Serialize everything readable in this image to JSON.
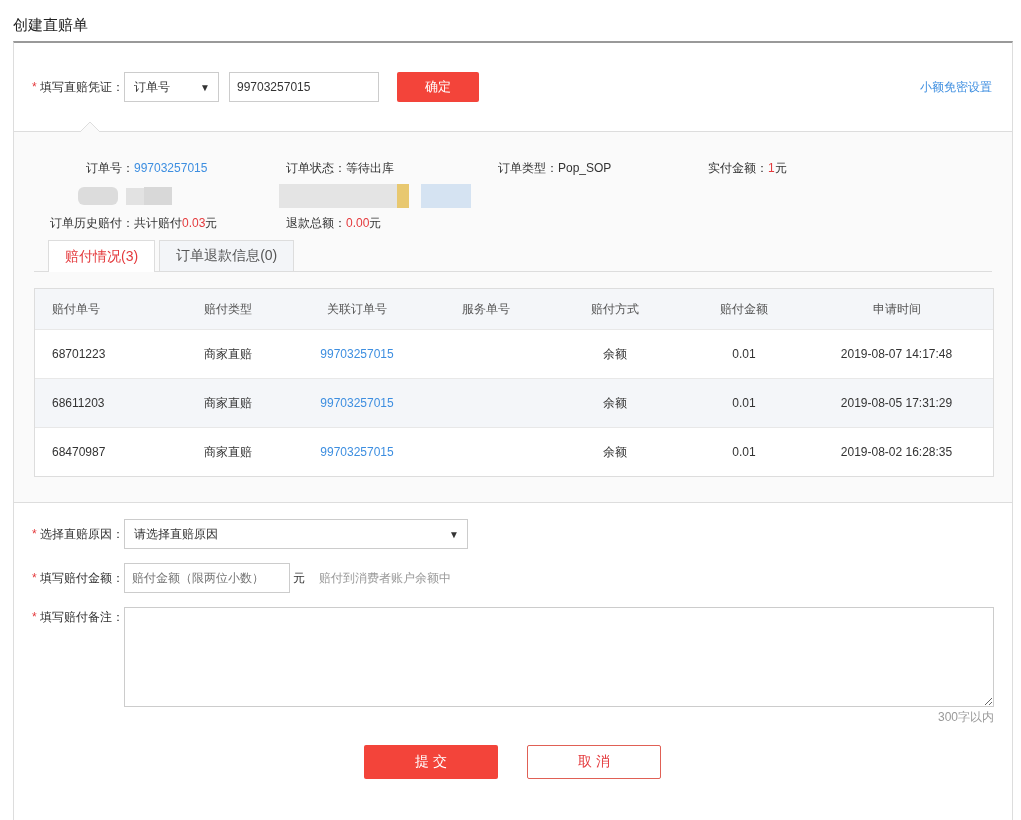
{
  "page_title": "创建直赔单",
  "voucher": {
    "label": "填写直赔凭证：",
    "select_value": "订单号",
    "select_arrow": "▼",
    "input_value": "99703257015",
    "confirm_button": "确定",
    "settings_link": "小额免密设置"
  },
  "order_info": {
    "rows": [
      [
        {
          "label": "订单号：",
          "value": "99703257015",
          "kind": "link"
        },
        {
          "label": "订单状态：等待出库",
          "kind": "plain"
        },
        {
          "label": "订单类型：Pop_SOP",
          "kind": "plain"
        },
        {
          "label": "实付金额：",
          "value": "1",
          "unit": "元",
          "kind": "amount"
        }
      ],
      [
        {
          "label": "订单历史赔付：共计赔付",
          "value": "0.03",
          "unit": "元",
          "kind": "amount"
        },
        {
          "label": "退款总额：",
          "value": "0.00",
          "unit": "元",
          "kind": "amount"
        }
      ]
    ]
  },
  "tabs": [
    {
      "label": "赔付情况(3)",
      "selected": true
    },
    {
      "label": "订单退款信息(0)",
      "selected": false
    }
  ],
  "table": {
    "columns": [
      "赔付单号",
      "赔付类型",
      "关联订单号",
      "服务单号",
      "赔付方式",
      "赔付金额",
      "申请时间"
    ],
    "rows": [
      [
        "68701223",
        "商家直赔",
        "99703257015",
        null,
        "余额",
        "0.01",
        "2019-08-07 14:17:48"
      ],
      [
        "68611203",
        "商家直赔",
        "99703257015",
        null,
        "余额",
        "0.01",
        "2019-08-05 17:31:29"
      ],
      [
        "68470987",
        "商家直赔",
        "99703257015",
        null,
        "余额",
        "0.01",
        "2019-08-02 16:28:35"
      ]
    ]
  },
  "form": {
    "reason_label": "选择直赔原因：",
    "reason_value": "请选择直赔原因",
    "reason_arrow": "▼",
    "amount_label": "填写赔付金额：",
    "amount_placeholder": "赔付金额（限两位小数）",
    "amount_unit": "元",
    "amount_hint": "赔付到消费者账户余额中",
    "note_label": "填写赔付备注：",
    "note_limit": "300字以内",
    "required_mark": "*"
  },
  "buttons": {
    "submit": "提 交",
    "cancel": "取 消"
  }
}
